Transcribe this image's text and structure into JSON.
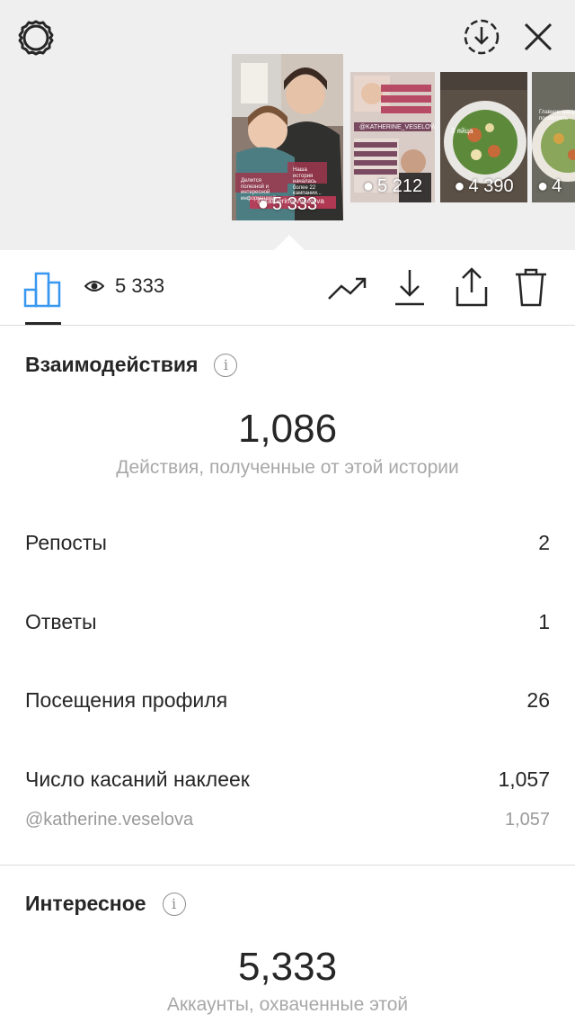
{
  "stories": {
    "active": {
      "views": "5 333",
      "caption_top": "Наша история началась более 22 кампании...",
      "caption_left": "Делится полезной и интересной информацией",
      "handle_tag": "@katherine.veselova"
    },
    "thumbs": [
      {
        "views": "5 212",
        "tag": "@KATHERINE_VESELOVA",
        "color": "#b7a3a0"
      },
      {
        "views": "4 390",
        "tag": "3 яйца",
        "color": "#7d8a55"
      },
      {
        "views": "4",
        "tag": "Главное сразу посмотреть",
        "color": "#a3ad80"
      }
    ]
  },
  "toolbar": {
    "views_count": "5 333"
  },
  "interactions": {
    "title": "Взаимодействия",
    "total": "1,086",
    "subtitle": "Действия, полученные от этой истории",
    "rows": [
      {
        "label": "Репосты",
        "value": "2"
      },
      {
        "label": "Ответы",
        "value": "1"
      },
      {
        "label": "Посещения профиля",
        "value": "26"
      },
      {
        "label": "Число касаний наклеек",
        "value": "1,057"
      }
    ],
    "sticker_sub": {
      "label": "@katherine.veselova",
      "value": "1,057"
    }
  },
  "discovery": {
    "title": "Интересное",
    "total": "5,333",
    "subtitle": "Аккаунты, охваченные этой"
  },
  "colors": {
    "accent_blue": "#3897f0",
    "text": "#262626",
    "secondary": "#a8a8a8",
    "top_bg": "#efeff0"
  }
}
